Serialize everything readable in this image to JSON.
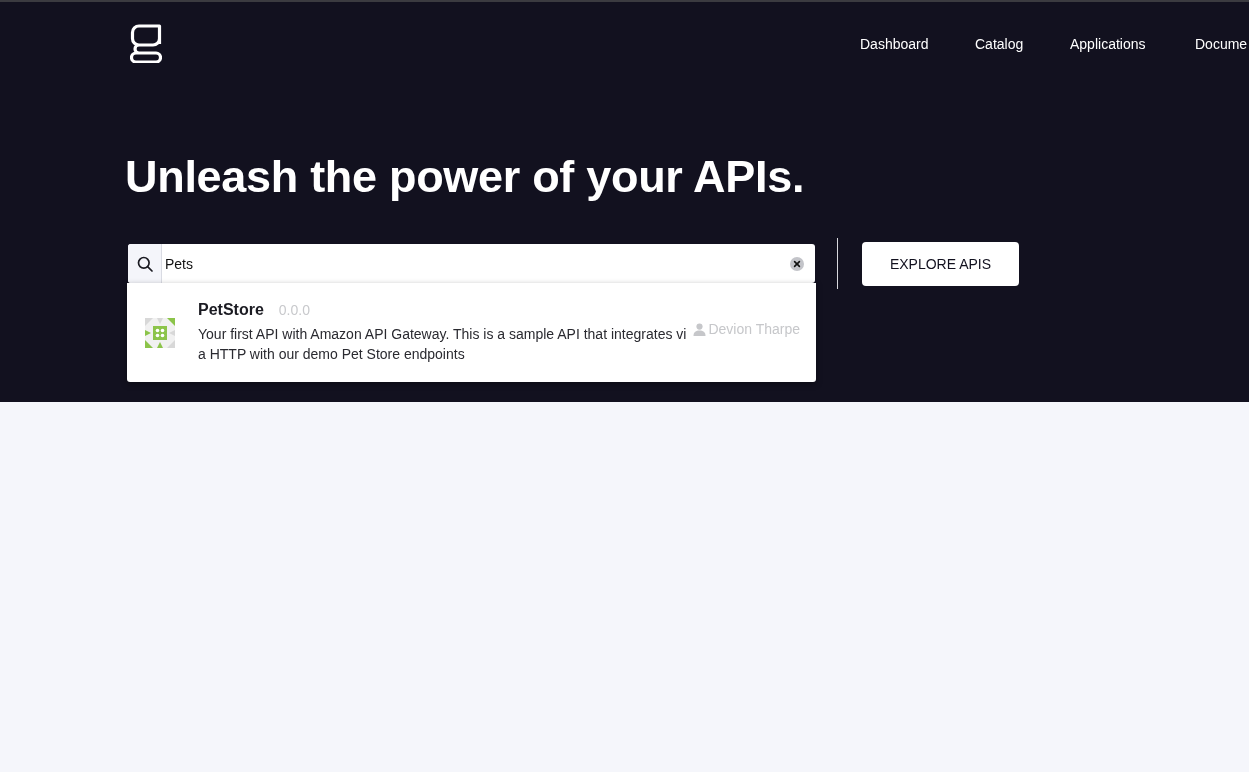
{
  "header": {
    "nav": [
      "Dashboard",
      "Catalog",
      "Applications",
      "Docume"
    ]
  },
  "hero": {
    "title": "Unleash the power of your APIs."
  },
  "search": {
    "value": "Pets",
    "results": [
      {
        "name": "PetStore",
        "version": "0.0.0",
        "description": "Your first API with Amazon API Gateway. This is a sample API that integrates via HTTP with our demo Pet Store endpoints",
        "owner": "Devion Tharpe"
      }
    ]
  },
  "explore_button": "EXPLORE APIS"
}
